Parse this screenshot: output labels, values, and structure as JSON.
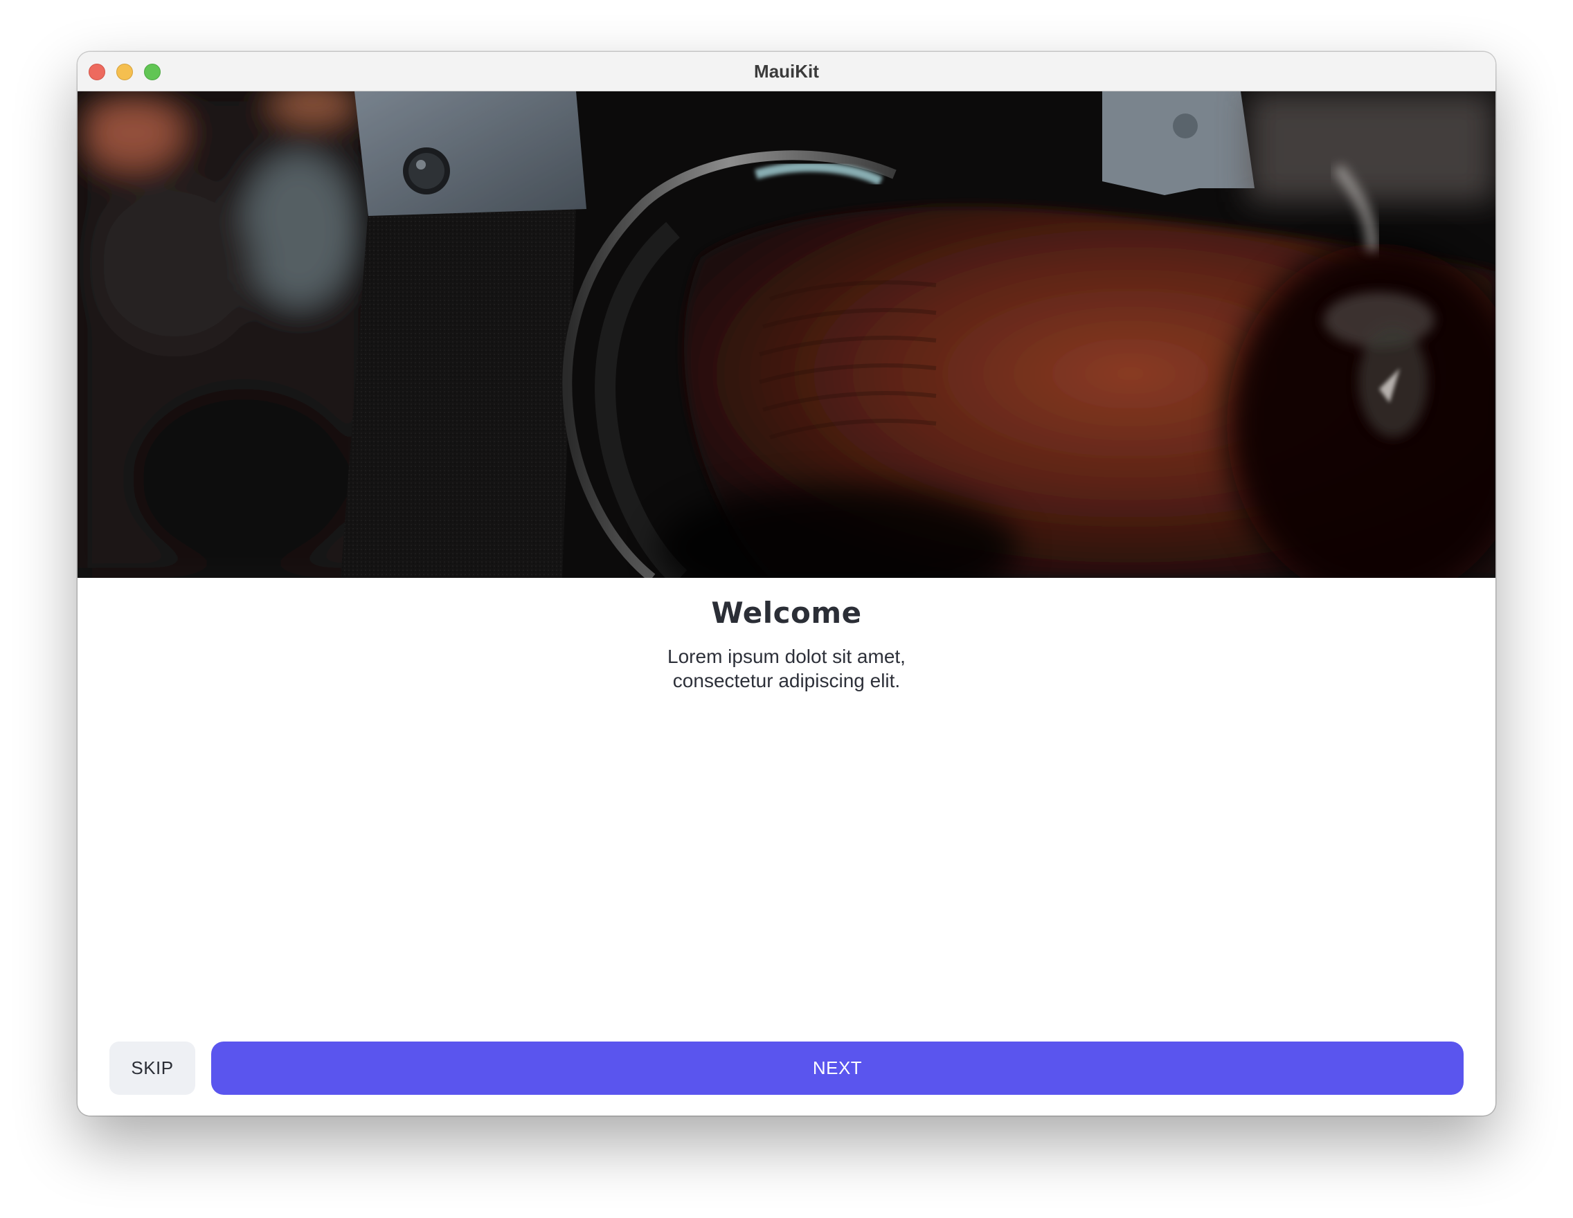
{
  "window": {
    "title": "MauiKit"
  },
  "hero": {
    "image": "camera-lens-photo"
  },
  "onboarding": {
    "heading": "Welcome",
    "body_line1": "Lorem ipsum dolot sit amet,",
    "body_line2": "consectetur adipiscing elit."
  },
  "actions": {
    "skip_label": "SKIP",
    "next_label": "NEXT"
  },
  "colors": {
    "accent": "#5a55ee",
    "secondary_button": "#eef0f4",
    "text": "#2b2e36"
  }
}
